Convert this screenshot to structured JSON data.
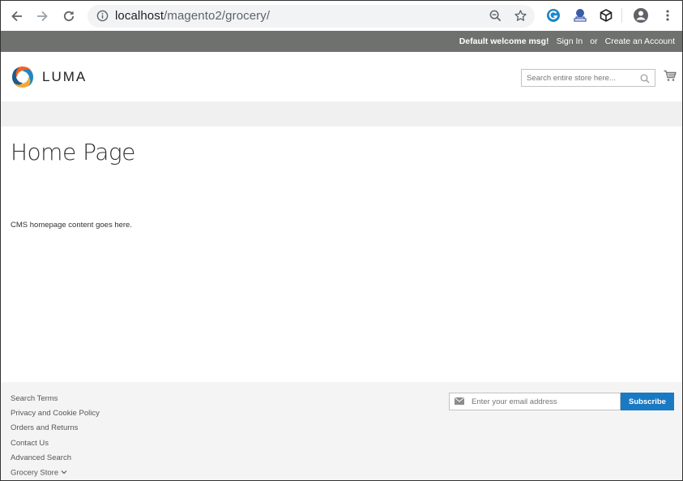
{
  "browser": {
    "url_host": "localhost",
    "url_path": "/magento2/grocery/",
    "icons": [
      "back-arrow-icon",
      "forward-arrow-icon",
      "reload-icon",
      "info-icon",
      "zoom-out-icon",
      "star-icon",
      "grammarly-icon",
      "extension-icon",
      "cube-extension-icon",
      "profile-icon",
      "more-vert-icon"
    ]
  },
  "header": {
    "welcome": "Default welcome msg!",
    "sign_in": "Sign In",
    "or": "or",
    "create_account": "Create an Account",
    "logo_text": "LUMA",
    "search_placeholder": "Search entire store here..."
  },
  "main": {
    "title": "Home Page",
    "content": "CMS homepage content goes here."
  },
  "footer": {
    "links": [
      "Search Terms",
      "Privacy and Cookie Policy",
      "Orders and Returns",
      "Contact Us",
      "Advanced Search"
    ],
    "store_switcher": "Grocery Store",
    "newsletter_placeholder": "Enter your email address",
    "subscribe_label": "Subscribe"
  },
  "colors": {
    "panel_bar": "#6e716e",
    "accent_blue": "#1979c3",
    "logo_orange": "#f26322",
    "logo_blue": "#1e88c7"
  }
}
